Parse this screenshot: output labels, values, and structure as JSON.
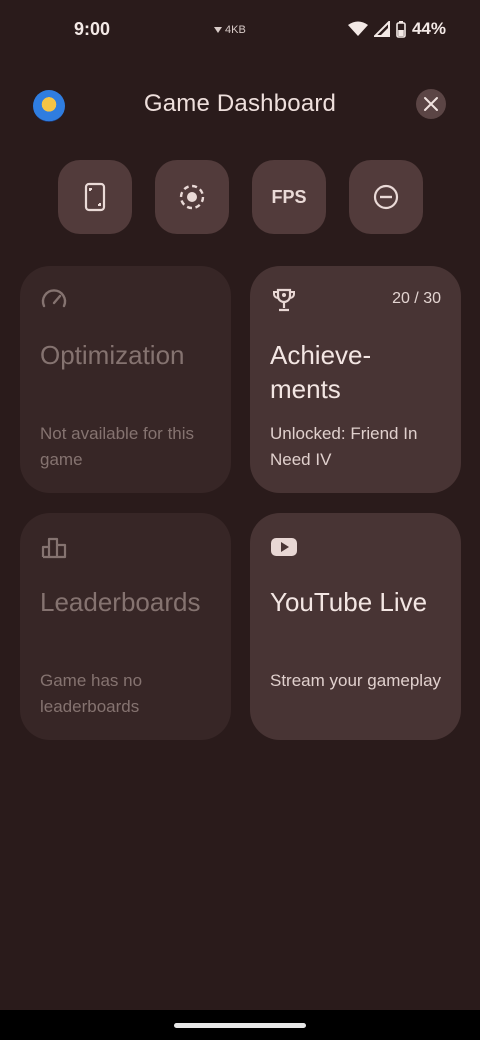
{
  "status": {
    "time": "9:00",
    "net_speed": "4KB",
    "battery": "44%",
    "icons": [
      "download-arrow-icon",
      "wifi-icon",
      "signal-icon",
      "battery-icon"
    ]
  },
  "header": {
    "title": "Game Dashboard",
    "icons": [
      "game-avatar",
      "close-icon"
    ]
  },
  "quick_actions": {
    "fps_label": "FPS",
    "icons": [
      "screenshot-icon",
      "record-icon",
      "fps-label",
      "do-not-disturb-icon"
    ]
  },
  "cards": {
    "optimization": {
      "title": "Optimization",
      "subtitle": "Not available for this game",
      "icon": "speedometer-icon"
    },
    "achievements": {
      "title": "Achieve-\nments",
      "count": "20 / 30",
      "subtitle": "Unlocked: Friend In Need IV",
      "icon": "trophy-icon"
    },
    "leaderboards": {
      "title": "Leaderboards",
      "subtitle": "Game has no leaderboards",
      "icon": "leaderboard-icon"
    },
    "youtube": {
      "title": "YouTube Live",
      "subtitle": "Stream your gameplay",
      "icon": "youtube-icon"
    }
  },
  "colors": {
    "background": "#2a1b1b",
    "card_enabled": "#483434",
    "card_disabled": "#372626",
    "quick_button": "#523b3b"
  }
}
